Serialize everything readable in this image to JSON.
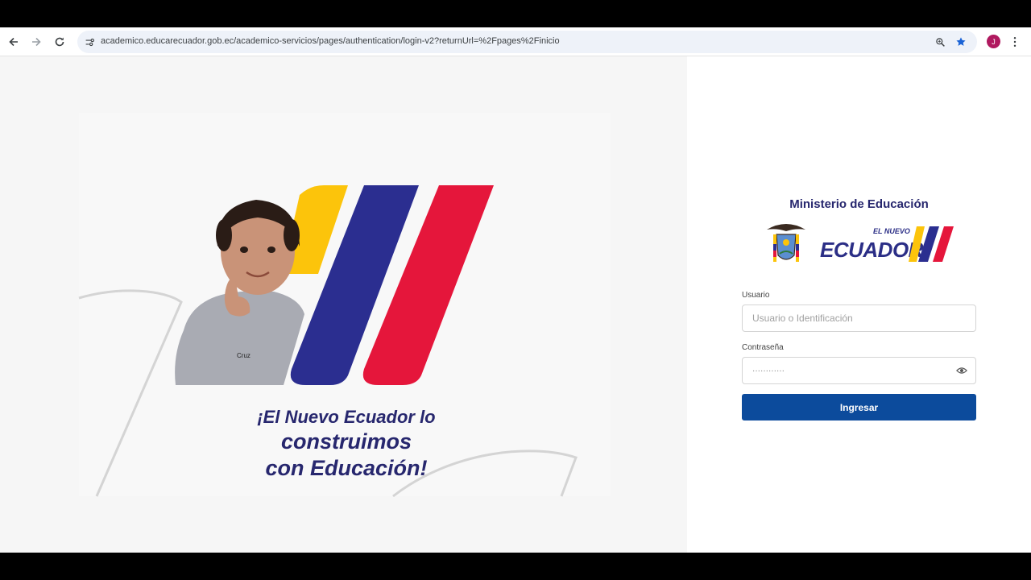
{
  "browser": {
    "url": "academico.educarecuador.gob.ec/academico-servicios/pages/authentication/login-v2?returnUrl=%2Fpages%2Finicio",
    "profile_initial": "J"
  },
  "hero": {
    "slogan_part1": "¡El Nuevo Ecuador lo ",
    "slogan_part2": "construimos",
    "slogan_line2": "con Educación!",
    "shirt_text": "Cruz",
    "stripe_colors": [
      "#fcc40b",
      "#2b2e90",
      "#e5163b"
    ]
  },
  "login": {
    "ministry": "Ministerio de Educación",
    "logo_small": "EL NUEVO",
    "logo_main": "ECUADOR",
    "user_label": "Usuario",
    "user_placeholder": "Usuario o Identificación",
    "password_label": "Contraseña",
    "password_value": "············",
    "submit_label": "Ingresar"
  }
}
